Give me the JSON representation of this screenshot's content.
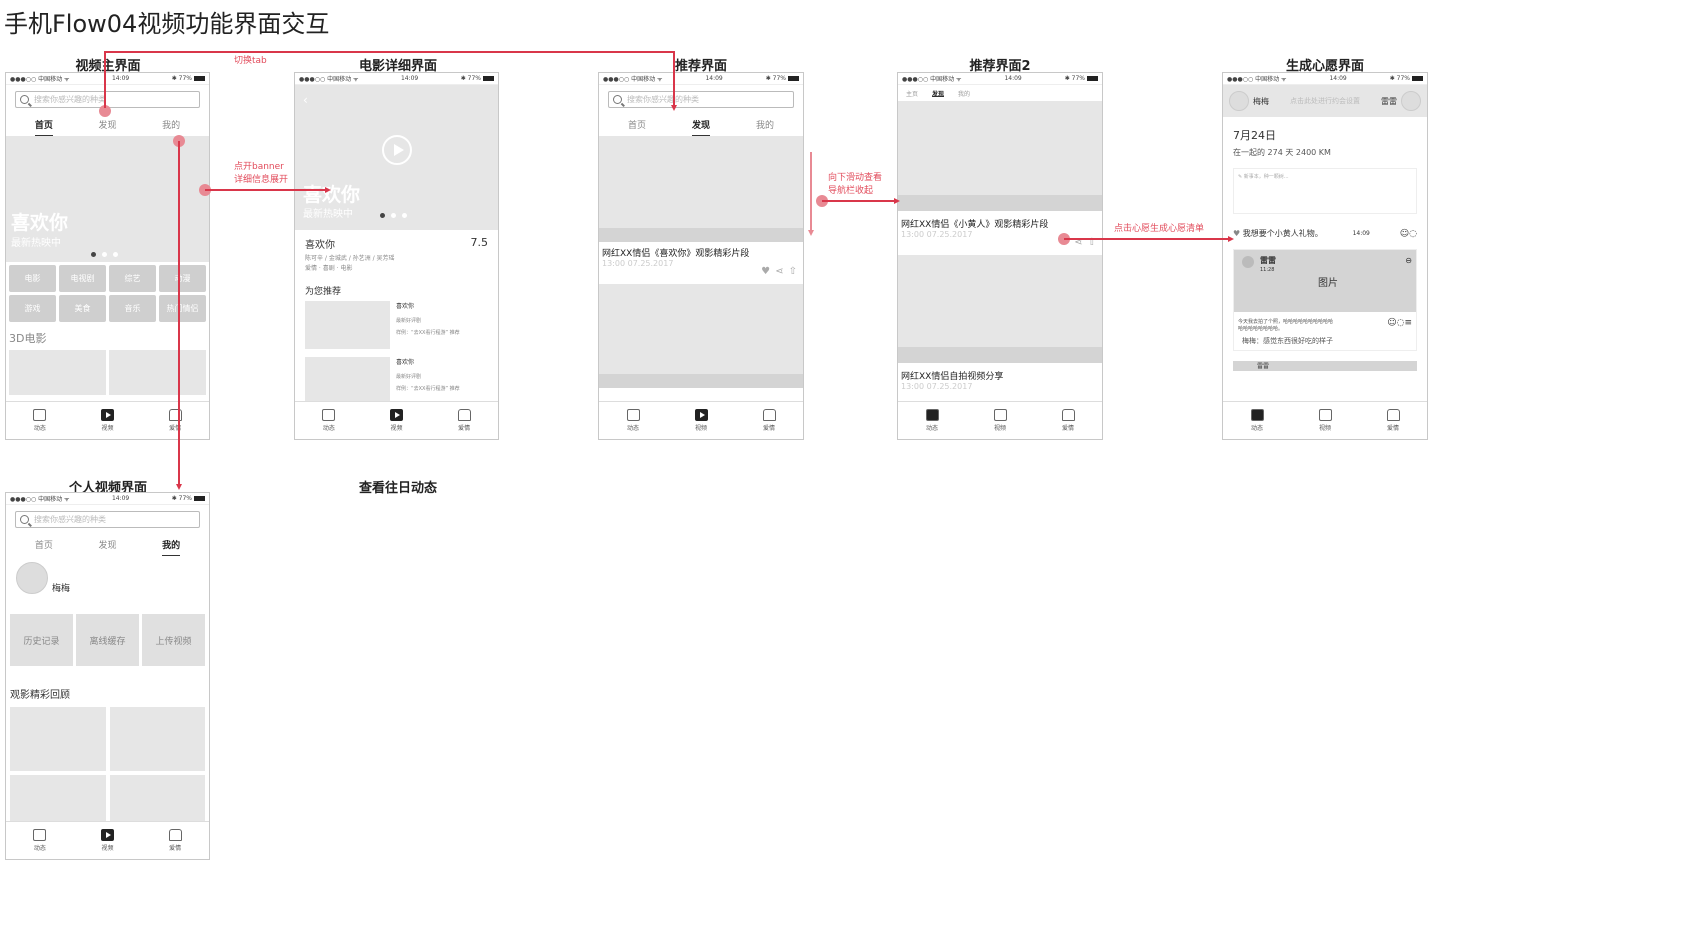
{
  "doc_title": "手机Flow04视频功能界面交互",
  "screen_titles": {
    "video_main": "视频主界面",
    "movie_detail": "电影详细界面",
    "recommend": "推荐界面",
    "recommend2": "推荐界面2",
    "wish": "生成心愿界面",
    "personal": "个人视频界面",
    "history": "查看往日动态"
  },
  "status": {
    "carrier": "●●●○○ 中国移动 ᯤ",
    "time": "14:09",
    "battery": "✱ 77%"
  },
  "search_placeholder": "搜索你感兴趣的种类",
  "tabs": {
    "home": "首页",
    "discover": "发现",
    "mine": "我的"
  },
  "bottom_nav": {
    "moments": "动态",
    "video": "视频",
    "love": "爱情"
  },
  "annotations": {
    "switch_tab": "切换tab",
    "open_banner_1": "点开banner",
    "open_banner_2": "详细信息展开",
    "scroll_down_1": "向下滑动查看",
    "scroll_down_2": "导航栏收起",
    "wish_gen": "点击心愿生成心愿清单"
  },
  "main": {
    "banner_big": "喜欢你",
    "banner_small": "最新热映中",
    "categories": [
      "电影",
      "电视剧",
      "综艺",
      "动漫",
      "游戏",
      "美食",
      "音乐",
      "热门情侣"
    ],
    "section": "3D电影"
  },
  "detail": {
    "banner_big": "喜欢你",
    "banner_small": "最新热映中",
    "movie_name": "喜欢你",
    "rating": "7.5",
    "credits": "陈可辛 / 金城武 / 孙艺洲 / 吴芳瑶",
    "genre": "爱情 · 喜剧 · 电影",
    "recommend_heading": "为您推荐",
    "rec_items": [
      {
        "name": "喜欢你",
        "line1": "最新好评剧",
        "line2": "样例：“去XX看行程游” 推荐"
      },
      {
        "name": "喜欢你",
        "line1": "最新好评剧",
        "line2": "样例：“去XX看行程游” 推荐"
      }
    ]
  },
  "recommend": {
    "video_title": "网红XX情侣《喜欢你》观影精彩片段",
    "video_meta": "13:00 07.25.2017"
  },
  "recommend2": {
    "tabs": [
      "主页",
      "发现",
      "我的"
    ],
    "video1_title": "网红XX情侣《小黄人》观影精彩片段",
    "video1_meta": "13:00 07.25.2017",
    "video2_title": "网红XX情侣自拍视频分享",
    "video2_meta": "13:00 07.25.2017"
  },
  "wish": {
    "user_left": "梅梅",
    "hint": "点击此处进行约会设置",
    "user_right": "雷雷",
    "date": "7月24日",
    "together": "在一起的 274 天   2400 KM",
    "input_hint": "新事本，种一颗树...",
    "wish_text": "我想要个小黄人礼物。",
    "wish_time": "14:09",
    "card_user": "雷雷",
    "card_time": "11:28",
    "card_image": "图片",
    "card_caption_1": "今天我去拍了个照，哈哈哈哈哈哈哈哈哈哈",
    "card_caption_2": "哈哈哈哈哈哈哈哈。",
    "comment": "梅梅：感觉东西很好吃的样子",
    "next_card": "雷雷"
  },
  "personal": {
    "username": "梅梅",
    "buttons": [
      "历史记录",
      "离线缓存",
      "上传视频"
    ],
    "section": "观影精彩回顾"
  }
}
